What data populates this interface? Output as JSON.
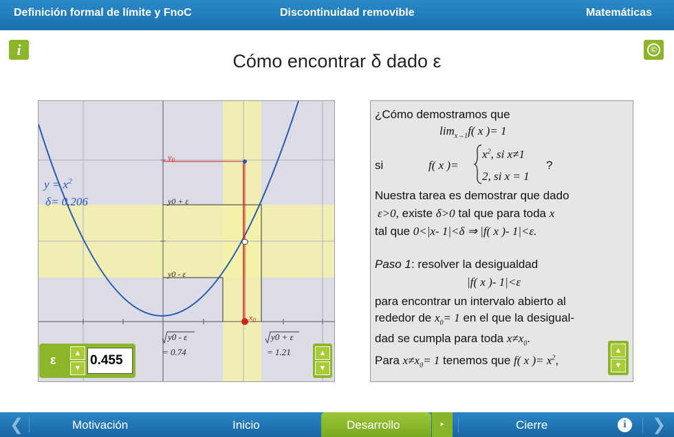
{
  "header": {
    "left": "Definición formal de límite y FnoC",
    "center": "Discontinuidad removible",
    "right": "Matemáticas"
  },
  "info_icon_glyph": "i",
  "copyright_glyph": "©",
  "page_title": "Cómo encontrar δ dado ε",
  "graph": {
    "curve_label": "y = x",
    "curve_exponent": "2",
    "delta_text": "δ= 0.206",
    "y0": "y",
    "y0_sub": "0",
    "y0_plus": "y",
    "y0_plus_rest": "0 + ε",
    "y0_minus": "y",
    "y0_minus_rest": "0 - ε",
    "x0": "x",
    "x0_sub": "0",
    "left_root_expr": "y0 - ε",
    "left_root_val": "= 0.74",
    "right_root_expr": "y0 + ε",
    "right_root_val": "= 1.21",
    "colors": {
      "band": "#f3f1a8",
      "curve": "#2558b3",
      "red": "#d42020",
      "panel": "#dcdce6"
    }
  },
  "epsilon": {
    "label": "ε",
    "value": "0.455",
    "up_icon": "▲",
    "down_icon": "▼"
  },
  "text": {
    "q1": "¿Cómo demostramos que",
    "lim": "lim",
    "lim_sub": "x→1",
    "lim_rest": "f( x )= 1",
    "si": "si",
    "fx": "f( x )=",
    "case1": "x",
    "case1_exp": "2",
    "case1_rest": ", si x≠1",
    "case2": "2, si x = 1",
    "qmark": "?",
    "l1": "Nuestra tarea es demostrar que dado",
    "l2a": "ε>0,",
    "l2b": " existe ",
    "l2c": "δ>0",
    "l2d": " tal que para toda ",
    "l2e": "x",
    "l3a": "tal que ",
    "l3b": "0<|x- 1|<δ  ⇒  |f( x )- 1|<ε.",
    "paso": "Paso 1",
    "paso_rest": ": resolver la desigualdad",
    "ineq": "|f( x )- 1|<ε",
    "l4": "para encontrar un intervalo abierto al",
    "l5a": "rededor de ",
    "l5b": "x",
    "l5b_sub": "0",
    "l5c": "= 1",
    "l5d": " en el que la desigual-",
    "l6a": "dad se cumpla para toda ",
    "l6b": "x≠x",
    "l6b_sub": "0",
    "l6c": ".",
    "l7a": "Para ",
    "l7b": "x≠x",
    "l7b_sub": "0",
    "l7c": "= 1",
    "l7d": " tenemos que ",
    "l7e": "f( x )= x",
    "l7e_exp": "2",
    "l7f": ","
  },
  "nav": {
    "motivacion": "Motivación",
    "inicio": "Inicio",
    "desarrollo": "Desarrollo",
    "cierre": "Cierre",
    "prev_icon": "❮",
    "next_icon": "❯",
    "dropdown_icon": "▸",
    "info_glyph": "i"
  }
}
